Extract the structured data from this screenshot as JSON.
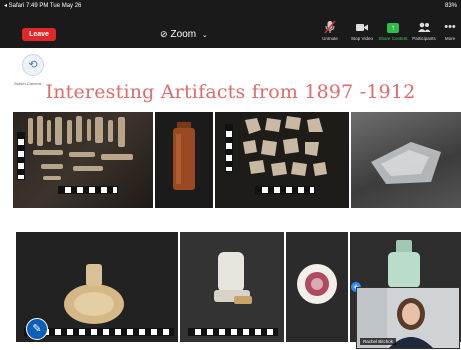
{
  "status_bar": {
    "left": "◂ Safari  7:49 PM  Tue May 26",
    "right": "83%"
  },
  "toolbar": {
    "leave_label": "Leave",
    "app_title": "Zoom",
    "buttons": [
      {
        "label": "Unmute",
        "icon": "mic-muted-icon"
      },
      {
        "label": "Stop Video",
        "icon": "video-icon"
      },
      {
        "label": "Share Content",
        "icon": "share-icon"
      },
      {
        "label": "Participants",
        "icon": "participants-icon"
      },
      {
        "label": "More",
        "icon": "more-icon"
      }
    ]
  },
  "slide": {
    "switch_camera_label": "Switch Camera",
    "title": "Interesting Artifacts from 1897 -1912"
  },
  "self_view": {
    "name": "Rachel Bitchok"
  },
  "colors": {
    "leave": "#e02828",
    "share": "#2ebd4a",
    "title": "#e06a6a",
    "accent": "#2d8cff"
  }
}
